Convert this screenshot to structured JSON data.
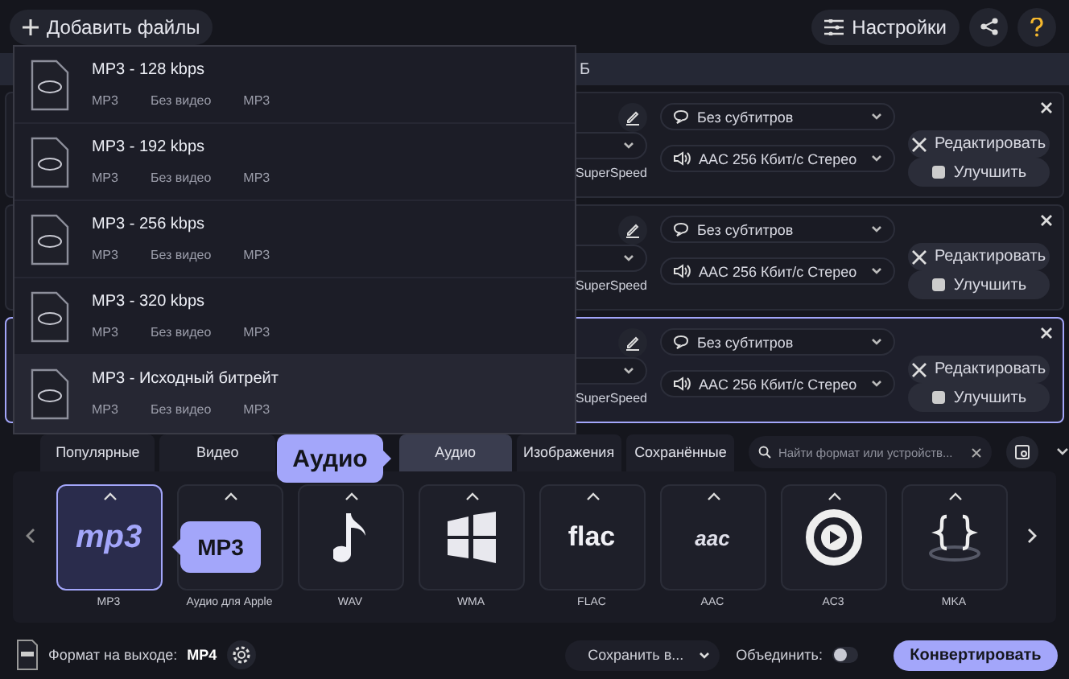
{
  "toolbar": {
    "add_files": "Добавить файлы",
    "settings": "Настройки"
  },
  "list_header": {
    "column_fragment": "Б"
  },
  "files": [
    {
      "subtitles": "Без субтитров",
      "audio": "AAC 256 Кбит/с Стерео",
      "speed_note": "SuperSpeed",
      "edit": "Редактировать",
      "enhance": "Улучшить",
      "selected": false
    },
    {
      "subtitles": "Без субтитров",
      "audio": "AAC 256 Кбит/с Стерео",
      "speed_note": "SuperSpeed",
      "edit": "Редактировать",
      "enhance": "Улучшить",
      "selected": false
    },
    {
      "subtitles": "Без субтитров",
      "audio": "AAC 256 Кбит/с Стерео",
      "speed_note": "SuperSpeed",
      "edit": "Редактировать",
      "enhance": "Улучшить",
      "selected": true
    }
  ],
  "preset_menu": {
    "items": [
      {
        "title": "MP3 - 128 kbps",
        "specs": [
          "MP3",
          "Без видео",
          "MP3"
        ],
        "selected": false
      },
      {
        "title": "MP3 - 192 kbps",
        "specs": [
          "MP3",
          "Без видео",
          "MP3"
        ],
        "selected": false
      },
      {
        "title": "MP3 - 256 kbps",
        "specs": [
          "MP3",
          "Без видео",
          "MP3"
        ],
        "selected": false
      },
      {
        "title": "MP3 - 320 kbps",
        "specs": [
          "MP3",
          "Без видео",
          "MP3"
        ],
        "selected": false
      },
      {
        "title": "MP3 - Исходный битрейт",
        "specs": [
          "MP3",
          "Без видео",
          "MP3"
        ],
        "selected": true
      }
    ]
  },
  "format_tabs": [
    {
      "label": "Популярные",
      "selected": false
    },
    {
      "label": "Видео",
      "selected": false
    },
    {
      "label": "Аудио",
      "selected": true
    },
    {
      "label": "Изображения",
      "selected": false
    },
    {
      "label": "Сохранённые",
      "selected": false
    }
  ],
  "format_search": {
    "placeholder": "Найти формат или устройств..."
  },
  "formats": [
    {
      "kind": "mp3",
      "label": "MP3",
      "logo": "mp3",
      "selected": true
    },
    {
      "kind": "apple",
      "label": "Аудио для Apple",
      "selected": false
    },
    {
      "kind": "wav",
      "label": "WAV",
      "selected": false
    },
    {
      "kind": "wma",
      "label": "WMA",
      "selected": false
    },
    {
      "kind": "flac",
      "label": "FLAC",
      "logo": "flac",
      "selected": false
    },
    {
      "kind": "aac",
      "label": "AAC",
      "logo": "aac",
      "selected": false
    },
    {
      "kind": "ac3",
      "label": "AC3",
      "selected": false
    },
    {
      "kind": "mka",
      "label": "MKA",
      "selected": false
    }
  ],
  "tooltips": {
    "tab": "Аудио",
    "format": "MP3"
  },
  "footer": {
    "output_label": "Формат на выходе:",
    "output_format": "MP4",
    "save_to": "Сохранить в...",
    "merge_label": "Объединить:",
    "merge_on": false,
    "convert": "Конвертировать"
  }
}
